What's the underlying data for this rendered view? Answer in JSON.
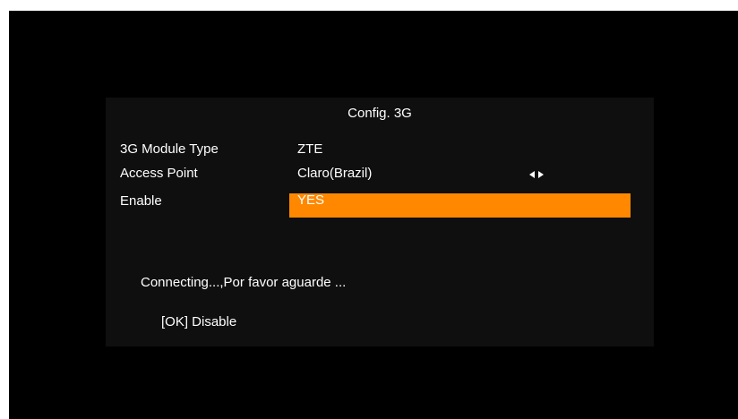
{
  "dialog": {
    "title": "Config. 3G",
    "fields": [
      {
        "label": "3G Module Type",
        "value": "ZTE"
      },
      {
        "label": "Access Point",
        "value": "Claro(Brazil)",
        "has_arrows": true
      },
      {
        "label": "Enable",
        "value": "YES",
        "selected": true
      }
    ],
    "status": "Connecting...,Por favor aguarde ...",
    "hint": "[OK] Disable"
  },
  "icons": {
    "access_point_arrows": "left-right-arrows-icon"
  },
  "colors": {
    "screen_bg": "#000000",
    "panel_bg": "#0f0f0f",
    "highlight": "#ff8800",
    "text": "#ffffff"
  }
}
